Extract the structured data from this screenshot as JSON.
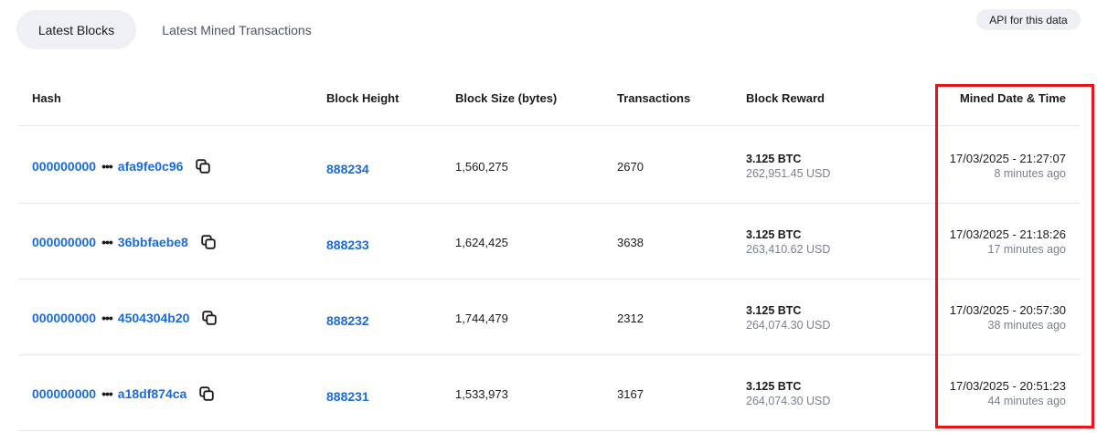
{
  "tabs": [
    {
      "label": "Latest Blocks",
      "active": true
    },
    {
      "label": "Latest Mined Transactions",
      "active": false
    }
  ],
  "api_button": "API for this data",
  "columns": [
    "Hash",
    "Block Height",
    "Block Size (bytes)",
    "Transactions",
    "Block Reward",
    "Mined Date & Time"
  ],
  "rows": [
    {
      "hash_prefix": "000000000",
      "hash_suffix": "afa9fe0c96",
      "height": "888234",
      "size": "1,560,275",
      "txs": "2670",
      "reward_btc": "3.125 BTC",
      "reward_usd": "262,951.45 USD",
      "datetime": "17/03/2025 - 21:27:07",
      "ago": "8 minutes ago"
    },
    {
      "hash_prefix": "000000000",
      "hash_suffix": "36bbfaebe8",
      "height": "888233",
      "size": "1,624,425",
      "txs": "3638",
      "reward_btc": "3.125 BTC",
      "reward_usd": "263,410.62 USD",
      "datetime": "17/03/2025 - 21:18:26",
      "ago": "17 minutes ago"
    },
    {
      "hash_prefix": "000000000",
      "hash_suffix": "4504304b20",
      "height": "888232",
      "size": "1,744,479",
      "txs": "2312",
      "reward_btc": "3.125 BTC",
      "reward_usd": "264,074.30 USD",
      "datetime": "17/03/2025 - 20:57:30",
      "ago": "38 minutes ago"
    },
    {
      "hash_prefix": "000000000",
      "hash_suffix": "a18df874ca",
      "height": "888231",
      "size": "1,533,973",
      "txs": "3167",
      "reward_btc": "3.125 BTC",
      "reward_usd": "264,074.30 USD",
      "datetime": "17/03/2025 - 20:51:23",
      "ago": "44 minutes ago"
    }
  ],
  "hash_separator": "•••",
  "colors": {
    "link": "#1a6ae0",
    "highlight": "#e8141b",
    "muted": "#7b8191"
  }
}
